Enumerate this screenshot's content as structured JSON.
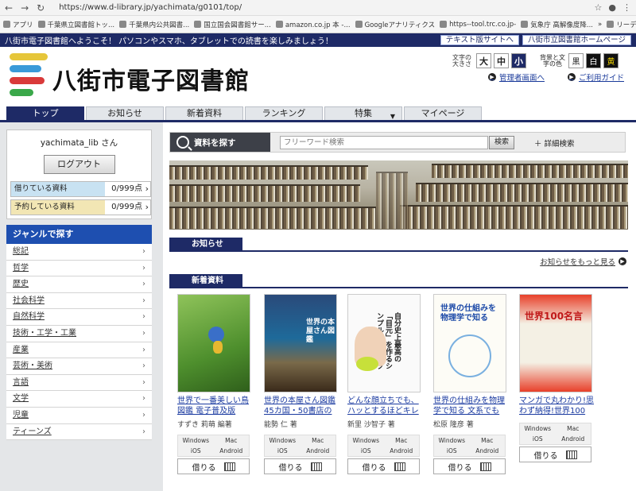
{
  "browser": {
    "url": "https://www.d-library.jp/yachimata/g0101/top/",
    "bookmarks": [
      "アプリ",
      "千葉県立図書館トッ...",
      "千葉県内公共図書...",
      "国立国会図書館サー...",
      "amazon.co.jp 本 -...",
      "Googleアナリティクス",
      "https--tool.trc.co.jp-",
      "気象庁 高解像度降...",
      "»",
      "リーディング リスト"
    ]
  },
  "strip": {
    "message": "八街市電子図書館へようこそ！ パソコンやスマホ、タブレットでの読書を楽しみましょう！",
    "text_site_label": "テキスト版サイトへ",
    "library_home_label": "八街市立図書館ホームページ"
  },
  "header": {
    "title": "八街市電子図書館",
    "size_label": "文字の大きさ",
    "size_options": [
      "大",
      "中",
      "小"
    ],
    "color_label": "背景と文字の色",
    "color_options": [
      "黒",
      "白",
      "黄"
    ],
    "admin_link": "管理者画面へ",
    "guide_link": "ご利用ガイド",
    "logo_colors": [
      "#e6c63a",
      "#3a9ad9",
      "#d93a3a",
      "#3aa84a"
    ]
  },
  "tabs": [
    "トップ",
    "お知らせ",
    "新着資料",
    "ランキング",
    "特集",
    "マイページ"
  ],
  "login": {
    "user": "yachimata_lib さん",
    "logout": "ログアウト",
    "borrowed_label": "借りている資料",
    "borrowed_count": "0/999点",
    "reserved_label": "予約している資料",
    "reserved_count": "0/999点"
  },
  "genres": {
    "title": "ジャンルで探す",
    "items": [
      "総記",
      "哲学",
      "歴史",
      "社会科学",
      "自然科学",
      "技術・工学・工業",
      "産業",
      "芸術・美術",
      "言語",
      "文学",
      "児童",
      "ティーンズ"
    ]
  },
  "search": {
    "label": "資料を探す",
    "placeholder": "フリーワード検索",
    "button": "検索",
    "advanced": "詳細検索"
  },
  "news": {
    "title": "お知らせ",
    "more": "お知らせをもっと見る"
  },
  "new_arrivals": {
    "title": "新着資料",
    "books": [
      {
        "title": "世界で一番美しい鳥図鑑 電子普及版",
        "author": "すずき 莉萌 編著",
        "cover_text": ""
      },
      {
        "title": "世界の本屋さん図鑑 45カ国・50書店の",
        "author": "能勢 仁 著",
        "cover_text": "世界の本屋さん図鑑"
      },
      {
        "title": "どんな顔立ちでも、ハッとするほどキレ",
        "author": "新里 沙智子 著",
        "cover_text": "自分史上最高の「目元」を作るシンプルテクニック"
      },
      {
        "title": "世界の仕組みを物理学で知る 文系でも",
        "author": "松原 隆彦 著",
        "cover_text": "世界の仕組みを物理学で知る"
      },
      {
        "title": "マンガで丸わかり!思わず納得!世界100",
        "author": "",
        "cover_text": "世界100名言"
      }
    ],
    "platforms": [
      "Windows",
      "Mac",
      "iOS",
      "Android"
    ],
    "borrow_label": "借りる"
  }
}
